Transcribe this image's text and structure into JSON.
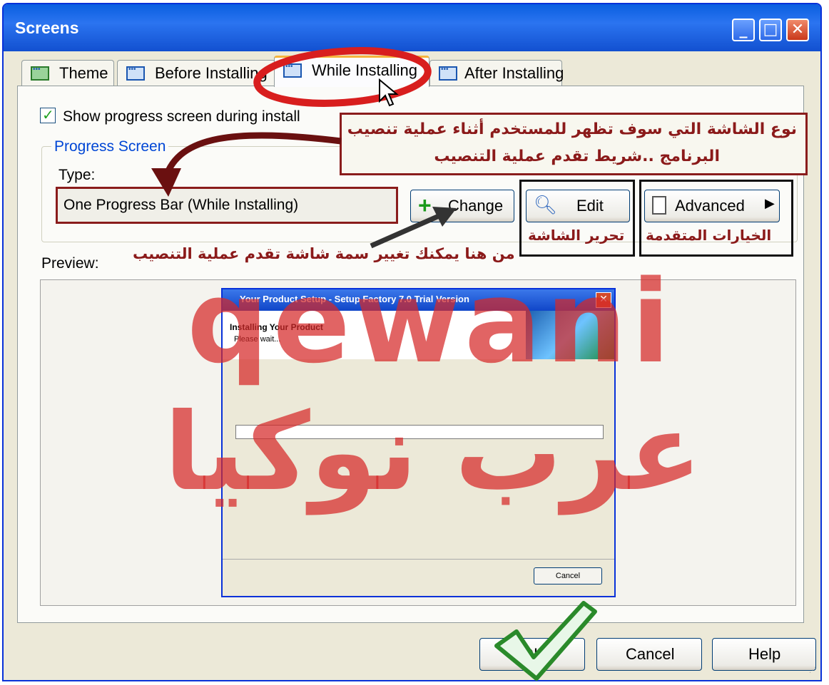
{
  "window": {
    "title": "Screens",
    "controls": [
      "minimize-icon",
      "maximize-icon",
      "close-icon"
    ],
    "accent": "#0831d9"
  },
  "tabs": [
    {
      "label": "Theme",
      "icon": "theme-icon"
    },
    {
      "label": "Before Installing",
      "icon": "screen-icon"
    },
    {
      "label": "While Installing",
      "icon": "screen-icon",
      "active": true
    },
    {
      "label": "After Installing",
      "icon": "screen-icon"
    }
  ],
  "settings": {
    "show_progress_label": "Show progress screen during install",
    "show_progress_checked": true,
    "group_label": "Progress Screen",
    "type_label": "Type:",
    "type_value": "One Progress Bar (While Installing)",
    "change_label": "Change",
    "edit_label": "Edit",
    "advanced_label": "Advanced",
    "preview_label": "Preview:"
  },
  "annotations": {
    "callout_line1": "نوع الشاشة التي سوف تظهر للمستخدم أثناء عملية تنصيب",
    "callout_line2": "البرنامج ..شريط تقدم عملية التنصيب",
    "change_note": "من هنا يمكنك تغيير سمة شاشة تقدم عملية التنصيب",
    "edit_note": "تحرير الشاشة",
    "advanced_note": "الخيارات المتقدمة",
    "annotation_color": "#8b1a1a"
  },
  "preview_window": {
    "title": "Your Product Setup - Setup Factory 7.0 Trial Version",
    "heading": "Installing Your Product",
    "subheading": "Please wait...",
    "cancel_label": "Cancel",
    "progress": 0
  },
  "watermark": {
    "latin": "qewani",
    "arabic": "عرب نوكيا",
    "color": "#d62828"
  },
  "footer": {
    "ok_label": "OK",
    "cancel_label": "Cancel",
    "help_label": "Help"
  }
}
